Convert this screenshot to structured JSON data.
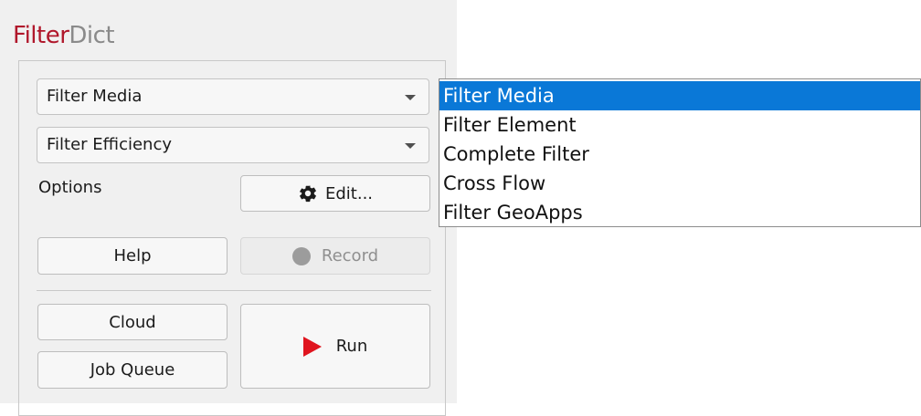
{
  "app": {
    "title_part1": "Filter",
    "title_part2": "Dict",
    "accent_color": "#b0172b"
  },
  "combos": {
    "media": {
      "value": "Filter Media"
    },
    "efficiency": {
      "value": "Filter Efficiency"
    }
  },
  "options": {
    "label": "Options",
    "edit_label": "Edit..."
  },
  "buttons": {
    "help": "Help",
    "record": "Record",
    "cloud": "Cloud",
    "job_queue": "Job Queue",
    "run": "Run"
  },
  "icons": {
    "edit": "gear-icon",
    "record": "record-dot-icon",
    "run": "play-icon"
  },
  "dropdown": {
    "selected_index": 0,
    "items": [
      "Filter Media",
      "Filter Element",
      "Complete Filter",
      "Cross Flow",
      "Filter GeoApps"
    ]
  }
}
